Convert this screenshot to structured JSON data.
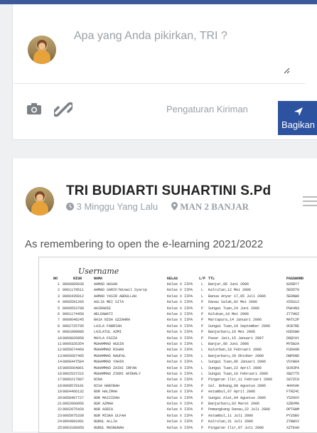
{
  "composer": {
    "placeholder": "Apa yang Anda pikirkan, TRI ?",
    "privacy_label": "Pengaturan Kiriman",
    "share_label": "Bagikan"
  },
  "post": {
    "author": "TRI BUDIARTI SUHARTINI S.Pd",
    "time": "3 Minggu Yang Lalu",
    "school": "MAN 2 BANJAR",
    "caption": "As remembering to open the e-learning 2021/2022",
    "document": {
      "handwritten": "Username",
      "headers": {
        "no": "NO",
        "nis": "NISN",
        "nama": "NAMA",
        "kelas": "KELAS",
        "lp": "L/P",
        "ttl": "TTL",
        "password": "PASSWORD"
      },
      "rows": [
        {
          "no": "1",
          "nis": "0066805039",
          "nama": "AHMAD HASAN",
          "kelas": "Kelas X IIPA",
          "lp": "L",
          "ttl": "Banjar,06 Juni 2006",
          "pw": "N35BY7"
        },
        {
          "no": "2",
          "nis": "0061179511",
          "nama": "AHMAD SARIF/Winwil Syarip",
          "kelas": "Kelas X IIPA",
          "lp": "L",
          "ttl": "Kalrulan,12 Mei 2006",
          "pw": "5ED5T9"
        },
        {
          "no": "3",
          "nis": "0066435812",
          "nama": "AHMAD YASIR ABDULLAH",
          "kelas": "Kelas X IIPA",
          "lp": "L",
          "ttl": "Banua Anyar 17,05 Juli 2006",
          "pw": "5E9NW6"
        },
        {
          "no": "4",
          "nis": "0066591266",
          "nama": "AULIA MEI SITA",
          "kelas": "Kelas X IIPA",
          "lp": "P",
          "ttl": "Danau Salak,02 Mei 2006",
          "pw": "X55U12"
        },
        {
          "no": "5",
          "nis": "0069553708",
          "nama": "HAIRANIE",
          "kelas": "Kelas X IIPA",
          "lp": "P",
          "ttl": "Sungai Tuan,24 Juni 2006",
          "pw": "PGK4N3"
        },
        {
          "no": "6",
          "nis": "0061174458",
          "nama": "HELDAWATI",
          "kelas": "Kelas X IIPA",
          "lp": "P",
          "ttl": "Kalukan,19 Mei 2006",
          "pw": "Z77H6Z"
        },
        {
          "no": "7",
          "nis": "0069640245",
          "nama": "NAIA NIDA UZZAHRA",
          "kelas": "Kelas X IIPA",
          "lp": "P",
          "ttl": "Martapura,14 Januari 2006",
          "pw": "MATC2P"
        },
        {
          "no": "8",
          "nis": "0062725795",
          "nama": "LAILA FABRIAH",
          "kelas": "Kelas X IIPA",
          "lp": "P",
          "ttl": "Sungai Tuan,10 September 2006",
          "pw": "9CB7RE"
        },
        {
          "no": "9",
          "nis": "0081899086",
          "nama": "LAILATUL AZMI",
          "kelas": "Kelas X IIPA",
          "lp": "P",
          "ttl": "Banjarbaru,16 Mei 2006",
          "pw": "H3DXWH"
        },
        {
          "no": "10",
          "nis": "0069026950",
          "nama": "MAYLA FAIZA",
          "kelas": "Kelas X IIPA",
          "lp": "P",
          "ttl": "Pasar Jati,15 Januari 2007",
          "pw": "D8QYAY"
        },
        {
          "no": "11",
          "nis": "0069326354",
          "nama": "MUHAMMAD HUSIN",
          "kelas": "Kelas X IIPA",
          "lp": "L",
          "ttl": "Banjar,06 Juni 2006",
          "pw": "MY5W2A"
        },
        {
          "no": "12",
          "nis": "0056674460",
          "nama": "MUHAMMAD RIHAN",
          "kelas": "Kelas X IIPA",
          "lp": "L",
          "ttl": "Kalurban,18 Februari 2006",
          "pw": "FUDA9N"
        },
        {
          "no": "13",
          "nis": "0065687405",
          "nama": "MUHAMMAD NAUFAL",
          "kelas": "Kelas X IIPA",
          "lp": "L",
          "ttl": "Banjarbaru,29 Oktober 2006",
          "pw": "DWP6ND"
        },
        {
          "no": "14",
          "nis": "0068447584",
          "nama": "MUHAMMAD YAHIN",
          "kelas": "Kelas X IIPA",
          "lp": "L",
          "ttl": "Sungai Tuan,06 Januari 2006",
          "pw": "VSYW84"
        },
        {
          "no": "15",
          "nis": "0065664861",
          "nama": "MUHAMMAD ZAINI IRFAN",
          "kelas": "Kelas X IIPA",
          "lp": "L",
          "ttl": "Sungai Tuan,22 April 2006",
          "pw": "GCR3PA"
        },
        {
          "no": "16",
          "nis": "0062537222",
          "nama": "MUHAMMAD ZIKRI AFDHALY",
          "kelas": "Kelas X IIPA",
          "lp": "L",
          "ttl": "Sungai Tuan,10 Februari 2006",
          "pw": "XBZ7T5"
        },
        {
          "no": "17",
          "nis": "0066217087",
          "nama": "NINA",
          "kelas": "Kelas X IIPA",
          "lp": "P",
          "ttl": "Pingaran Ilir,11 Februari 2006",
          "pw": "S87ZC8"
        },
        {
          "no": "18",
          "nis": "0068570181",
          "nama": "NISA HABIBAH",
          "kelas": "Kelas X IIPA",
          "lp": "P",
          "ttl": "Sal. Bobang,08 Agustus 2006",
          "pw": "4H4XAK"
        },
        {
          "no": "19",
          "nis": "0064466132",
          "nama": "NOR HALIMAH",
          "kelas": "Kelas X IIPA",
          "lp": "P",
          "ttl": "Astambul,07 April 2006",
          "pw": "FTRZ4C"
        },
        {
          "no": "20",
          "nis": "0058487727",
          "nama": "NOR MAIZIDAH",
          "kelas": "Kelas X IIPA",
          "lp": "P",
          "ttl": "Sungai Alat,04 Agustus 2006",
          "pw": "Y5ZHVV"
        },
        {
          "no": "21",
          "nis": "0062068956",
          "nama": "NUR AZMAH",
          "kelas": "Kelas X IIPA",
          "lp": "P",
          "ttl": "Banjarbaru,03 Maret 2006",
          "pw": "XZBVMA"
        },
        {
          "no": "22",
          "nis": "0062875420",
          "nama": "NUR ASRIA",
          "kelas": "Kelas X IIPA",
          "lp": "P",
          "ttl": "Pemangkang Danau,22 Juli 2006",
          "pw": "DPTGWM"
        },
        {
          "no": "23",
          "nis": "0065075339",
          "nama": "NUR MISKA ULFAH",
          "kelas": "Kelas X IIPA",
          "lp": "P",
          "ttl": "Astambul,11 Juli 2006",
          "pw": "PYZ6BV"
        },
        {
          "no": "24",
          "nis": "0064801001",
          "nama": "NURUL ALLIA",
          "kelas": "Kelas X IIPA",
          "lp": "P",
          "ttl": "Kalrulan,31 Juli 2006",
          "pw": "ZYBWV2"
        },
        {
          "no": "25",
          "nis": "0063186059",
          "nama": "NURUL MASNUNAH",
          "kelas": "Kelas X IIPA",
          "lp": "P",
          "ttl": "Pingaran Ilir,07 Juli 2006",
          "pw": "XZTEAH"
        }
      ]
    }
  },
  "colors": {
    "accent": "#2c52a0",
    "topbar": "#3c5a99",
    "muted": "#9aa0a6"
  },
  "icons": {
    "camera": "camera-icon",
    "link": "link-icon",
    "send": "send-icon",
    "clock": "clock-icon",
    "location": "location-pin-icon",
    "menu": "hamburger-menu-icon"
  }
}
